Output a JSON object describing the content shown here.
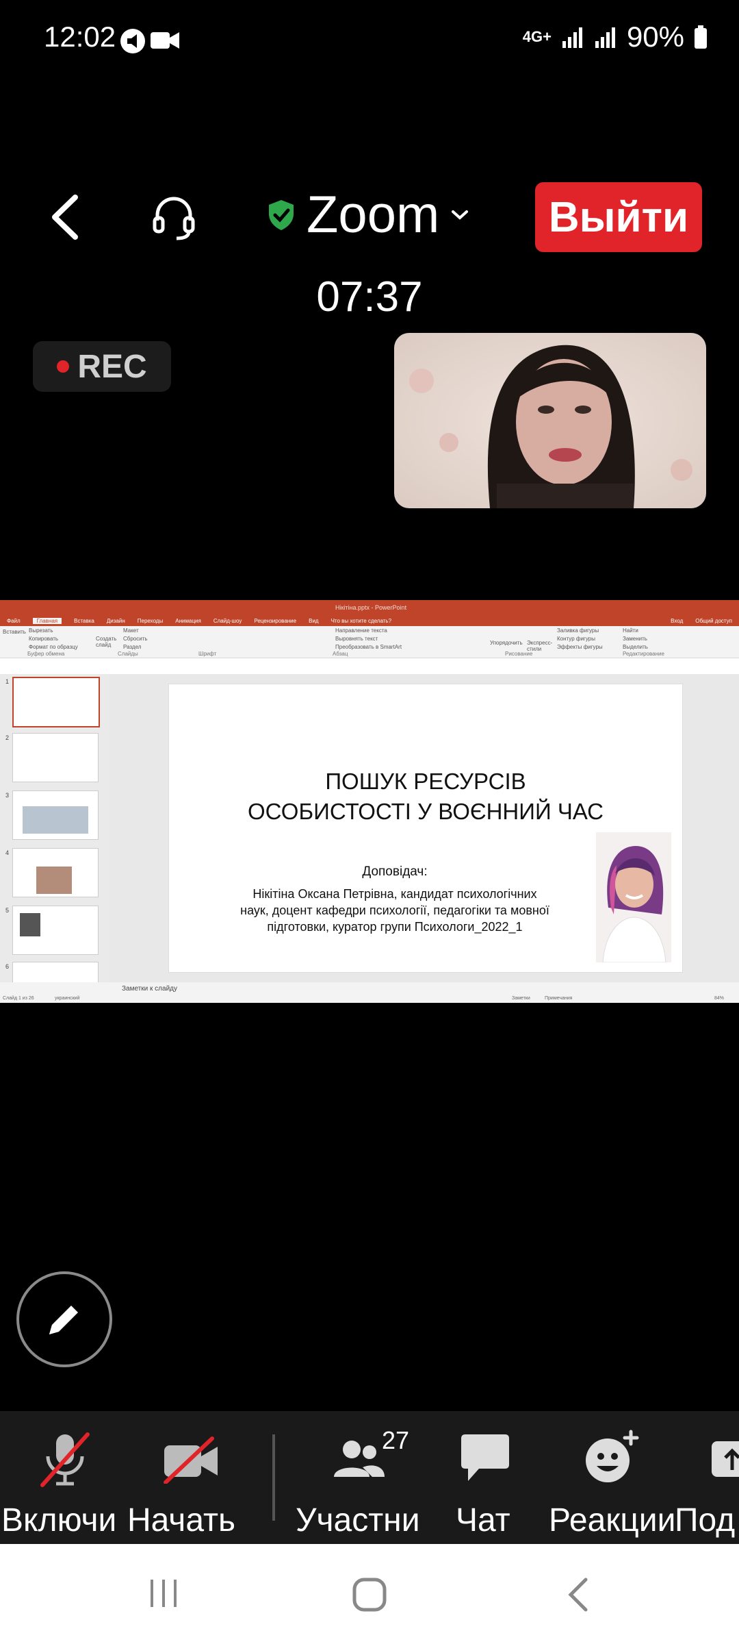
{
  "status_bar": {
    "time": "12:02",
    "network": "4G+",
    "battery": "90%"
  },
  "meeting": {
    "app_title": "Zoom",
    "exit_label": "Выйти",
    "timer": "07:37",
    "rec_label": "REC"
  },
  "presentation": {
    "window_title": "Нікітіна.pptx - PowerPoint",
    "tabs": [
      "Файл",
      "Главная",
      "Вставка",
      "Дизайн",
      "Переходы",
      "Анимация",
      "Слайд-шоу",
      "Рецензирование",
      "Вид",
      "Что вы хотите сделать?"
    ],
    "active_tab": "Главная",
    "share_label": "Общий доступ",
    "login_label": "Вход",
    "ribbon_groups": [
      "Буфер обмена",
      "Слайды",
      "Шрифт",
      "Абзац",
      "Рисование",
      "Редактирование"
    ],
    "ribbon_commands": [
      "Вставить",
      "Вырезать",
      "Копировать",
      "Формат по образцу",
      "Создать слайд",
      "Макет",
      "Сбросить",
      "Раздел",
      "Направление текста",
      "Выровнять текст",
      "Преобразовать в SmartArt",
      "Упорядочить",
      "Экспресс-стили",
      "Заливка фигуры",
      "Контур фигуры",
      "Эффекты фигуры",
      "Найти",
      "Заменить",
      "Выделить"
    ],
    "slide_numbers": [
      "1",
      "2",
      "3",
      "4",
      "5",
      "6"
    ],
    "slide_title_line1": "ПОШУК РЕСУРСІВ",
    "slide_title_line2": "ОСОБИСТОСТІ У ВОЄННИЙ ЧАС",
    "speaker_label": "Доповідач:",
    "speaker_text": "Нікітіна Оксана Петрівна, кандидат психологічних наук, доцент кафедри психології, педагогіки та мовної підготовки, куратор групи Психологи_2022_1",
    "notes_placeholder": "Заметки к слайду",
    "status_left": "Слайд 1 из 26",
    "status_lang": "украинский",
    "status_notes": "Заметки",
    "status_comments": "Примечания",
    "zoom_level": "84%"
  },
  "toolbar": {
    "items": [
      {
        "label": "Включи"
      },
      {
        "label": "Начать"
      },
      {
        "label": "Участни",
        "count": "27"
      },
      {
        "label": "Чат"
      },
      {
        "label": "Реакции"
      },
      {
        "label": "Под"
      }
    ]
  },
  "colors": {
    "exit": "#e0242a",
    "shield": "#2ea84a",
    "powerpoint": "#c0442a"
  }
}
